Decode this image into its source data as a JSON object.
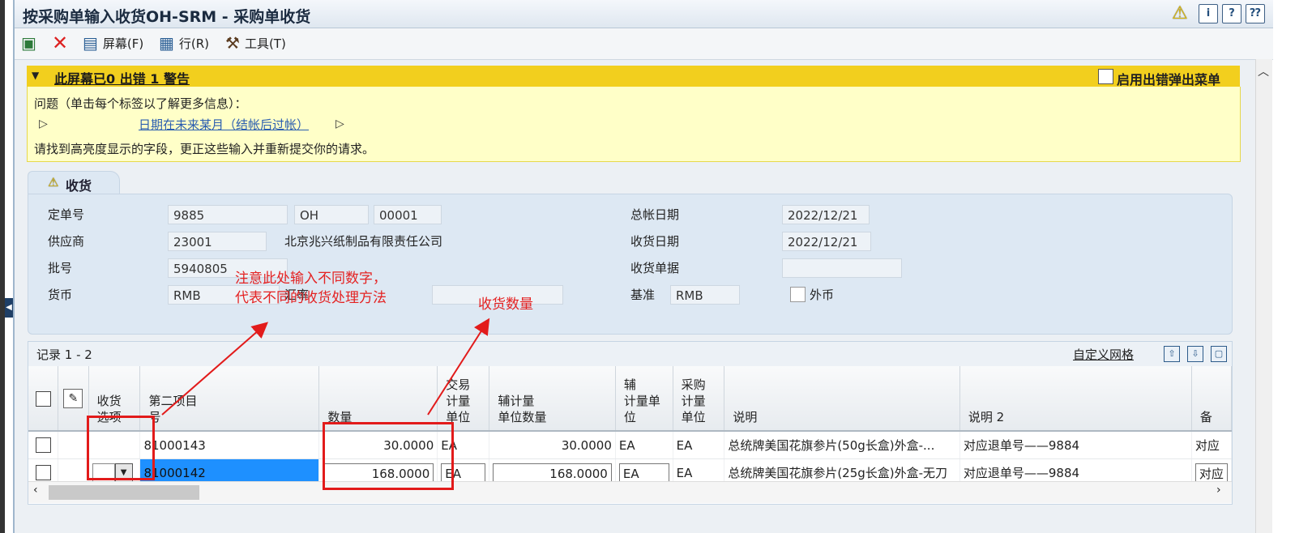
{
  "window": {
    "title": "按采购单输入收货OH-SRM - 采购单收货",
    "title_icons": [
      "warning-icon",
      "info-icon",
      "help-icon",
      "help-alt-icon"
    ]
  },
  "toolbar": {
    "screen_label": "屏幕(F)",
    "row_label": "行(R)",
    "tools_label": "工具(T)"
  },
  "errors": {
    "header": "此屏幕已0 出错 1 警告",
    "popup_checkbox_label": "启用出错弹出菜单",
    "problem_text": "问题（单击每个标签以了解更多信息）：",
    "link_text": "日期在未来某月（结帐后过帐）",
    "instruction": "请找到高亮度显示的字段，更正这些输入并重新提交你的请求。"
  },
  "tab": {
    "label": "收货"
  },
  "form": {
    "order_no_label": "定单号",
    "order_no": "9885",
    "order_type": "OH",
    "order_company": "00001",
    "supplier_label": "供应商",
    "supplier_code": "23001",
    "supplier_name": "北京兆兴纸制品有限责任公司",
    "batch_label": "批号",
    "batch_no": "5940805",
    "currency_label": "货币",
    "currency": "RMB",
    "rate_label": "汇率",
    "rate_value": "",
    "gl_date_label": "总帐日期",
    "gl_date": "2022/12/21",
    "receipt_date_label": "收货日期",
    "receipt_date": "2022/12/21",
    "receipt_doc_label": "收货单据",
    "receipt_doc": "",
    "base_label": "基准",
    "base_currency": "RMB",
    "foreign_label": "外币"
  },
  "annotations": {
    "note1_line1": "注意此处输入不同数字，",
    "note1_line2": "代表不同的收货处理方法",
    "note2": "收货数量"
  },
  "grid": {
    "records": "记录 1 - 2",
    "customize": "自定义网格",
    "columns": {
      "option": "收货\n选项",
      "item": "第二项目\n号",
      "qty": "数量",
      "tx_uom": "交易\n计量\n单位",
      "sec_qty": "辅计量\n单位数量",
      "sec_uom": "辅\n计量单\n位",
      "po_uom": "采购\n计量\n单位",
      "desc": "说明",
      "desc2": "说明 2",
      "remark": "备"
    },
    "rows": [
      {
        "item": "81000143",
        "qty": "30.0000",
        "tx_uom": "EA",
        "sec_qty": "30.0000",
        "sec_uom": "EA",
        "po_uom": "EA",
        "desc": "总统牌美国花旗参片(50g长盒)外盒-...",
        "desc2": "对应退单号——9884",
        "remark": "对应"
      },
      {
        "item": "81000142",
        "qty": "168.0000",
        "tx_uom": "EA",
        "sec_qty": "168.0000",
        "sec_uom": "EA",
        "po_uom": "EA",
        "desc": "总统牌美国花旗参片(25g长盒)外盒-无刀",
        "desc2": "对应退单号——9884",
        "remark": "对应"
      }
    ]
  }
}
